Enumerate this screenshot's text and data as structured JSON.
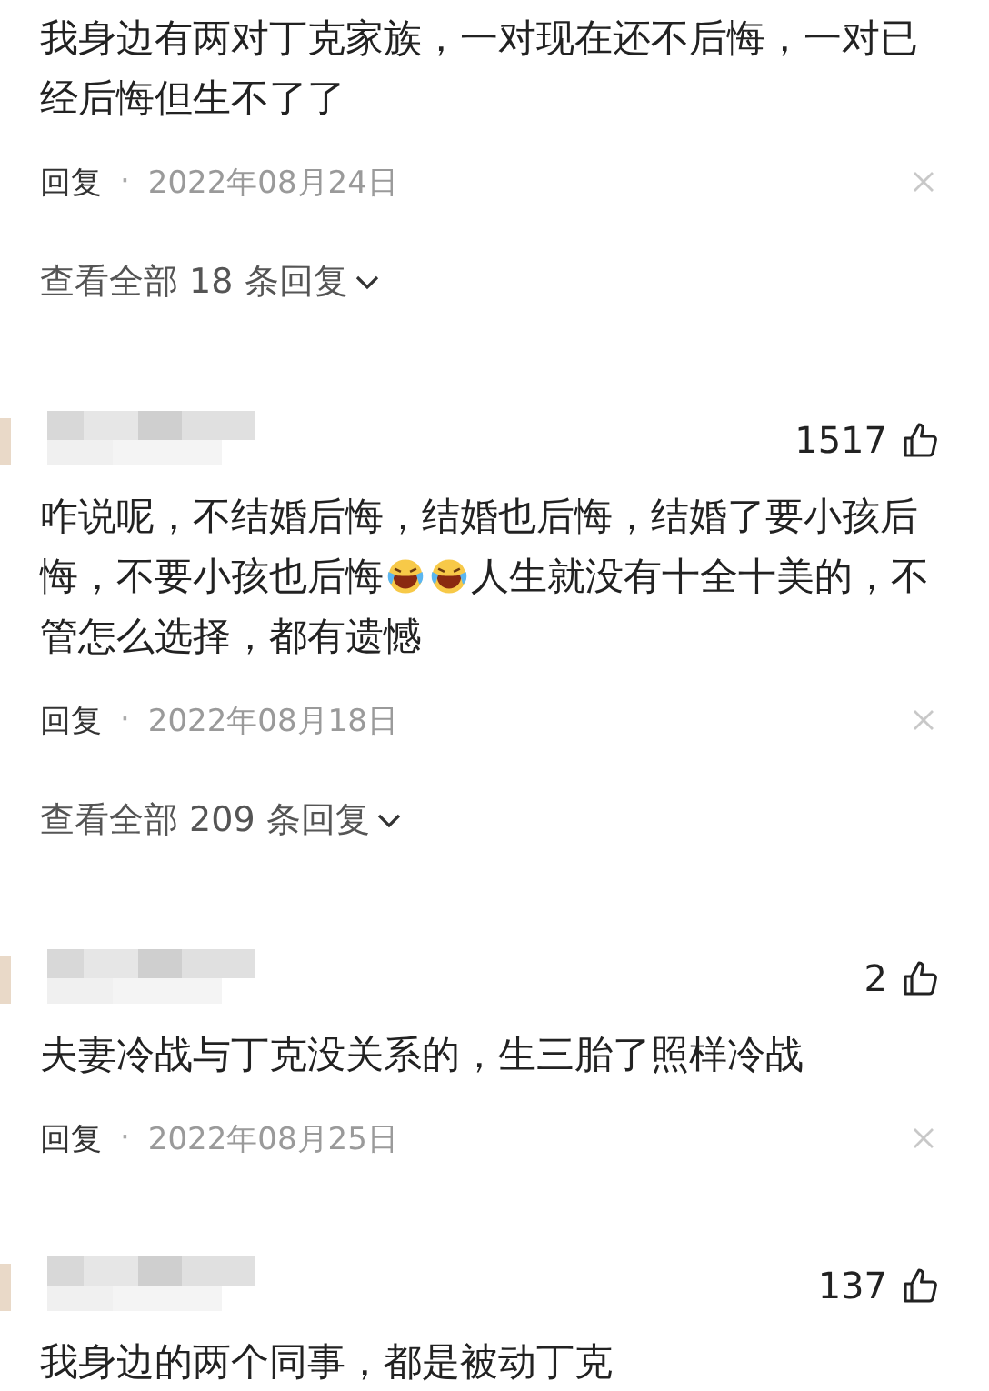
{
  "comments": [
    {
      "parts": [
        {
          "kind": "text",
          "text": "我身边有两对丁克家族，一对现在还不后悔，一对已经后悔但生不了了"
        }
      ],
      "reply_label": "回复",
      "separator": "·",
      "date": "2022年08月24日",
      "view_replies": "查看全部 18 条回复"
    },
    {
      "likes": "1517",
      "parts": [
        {
          "kind": "text",
          "text": "咋说呢，不结婚后悔，结婚也后悔，结婚了要小孩后悔，不要小孩也后悔"
        },
        {
          "kind": "emoji"
        },
        {
          "kind": "emoji"
        },
        {
          "kind": "text",
          "text": "人生就没有十全十美的，不管怎么选择，都有遗憾"
        }
      ],
      "reply_label": "回复",
      "separator": "·",
      "date": "2022年08月18日",
      "view_replies": "查看全部 209 条回复"
    },
    {
      "likes": "2",
      "parts": [
        {
          "kind": "text",
          "text": "夫妻冷战与丁克没关系的，生三胎了照样冷战"
        }
      ],
      "reply_label": "回复",
      "separator": "·",
      "date": "2022年08月25日"
    },
    {
      "likes": "137",
      "parts": [
        {
          "kind": "text",
          "text": "我身边的两个同事，都是被动丁克"
        }
      ]
    }
  ]
}
